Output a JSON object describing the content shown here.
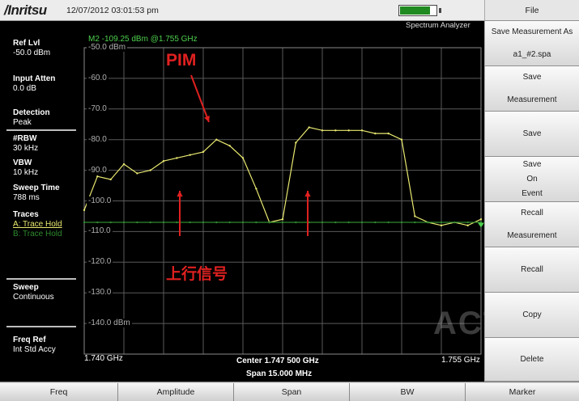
{
  "header": {
    "logo_text": "/Inritsu",
    "datetime": "12/07/2012 03:01:53 pm",
    "battery_level": 0.85,
    "mode_label": "Spectrum Analyzer"
  },
  "left_panel": {
    "ref_lvl": {
      "label": "Ref Lvl",
      "value": "-50.0 dBm"
    },
    "input_atten": {
      "label": "Input Atten",
      "value": "0.0 dB"
    },
    "detection": {
      "label": "Detection",
      "value": "Peak"
    },
    "rbw": {
      "label": "#RBW",
      "value": "30 kHz"
    },
    "vbw": {
      "label": "VBW",
      "value": "10 kHz"
    },
    "sweep_time": {
      "label": "Sweep Time",
      "value": "788 ms"
    },
    "traces": {
      "label": "Traces",
      "a": "A: Trace Hold",
      "b": "B: Trace Hold"
    },
    "sweep": {
      "label": "Sweep",
      "value": "Continuous"
    },
    "freq_ref": {
      "label": "Freq Ref",
      "value": "Int Std Accy"
    }
  },
  "right_panel": {
    "title": "File",
    "buttons": [
      {
        "line1": "Save Measurement As",
        "line2": "a1_#2.spa"
      },
      {
        "line1": "Save",
        "line2": "Measurement"
      },
      {
        "line1": "Save"
      },
      {
        "line1": "Save",
        "line2": "On",
        "line3": "Event"
      },
      {
        "line1": "Recall",
        "line2": "Measurement"
      },
      {
        "line1": "Recall"
      },
      {
        "line1": "Copy"
      },
      {
        "line1": "Delete"
      }
    ]
  },
  "bottom_tabs": [
    "Freq",
    "Amplitude",
    "Span",
    "BW",
    "Marker"
  ],
  "annotations": {
    "pim": "PIM",
    "uplink": "上行信号"
  },
  "watermark": "ACT",
  "chart_data": {
    "type": "line",
    "marker_readout": "M2 -109.25 dBm @1.755 GHz",
    "ytick_labels": [
      "-50.0 dBm",
      "-60.0",
      "-70.0",
      "-80.0",
      "-90.0",
      "-100.0",
      "-110.0",
      "-120.0",
      "-130.0",
      "-140.0 dBm"
    ],
    "ylim": [
      -150,
      -50
    ],
    "xlim": [
      1.74,
      1.755
    ],
    "x_start_label": "1.740 GHz",
    "x_end_label": "1.755 GHz",
    "center_label": "Center 1.747 500 GHz",
    "span_label": "Span 15.000 MHz",
    "grid": true,
    "series": [
      {
        "name": "A: Trace Hold",
        "color": "#e8e870",
        "x": [
          1.74,
          1.7405,
          1.741,
          1.7415,
          1.742,
          1.7425,
          1.743,
          1.7435,
          1.744,
          1.7445,
          1.745,
          1.7455,
          1.746,
          1.7465,
          1.747,
          1.7475,
          1.748,
          1.7485,
          1.749,
          1.7495,
          1.75,
          1.7505,
          1.751,
          1.7515,
          1.752,
          1.7525,
          1.753,
          1.7535,
          1.754,
          1.7545,
          1.755
        ],
        "y": [
          -103,
          -92,
          -93,
          -88,
          -91,
          -90,
          -87,
          -86,
          -85,
          -84,
          -80,
          -82,
          -86,
          -96,
          -107,
          -106,
          -81,
          -76,
          -77,
          -77,
          -77,
          -77,
          -78,
          -78,
          -80,
          -105,
          -107,
          -108,
          -107,
          -108,
          -106
        ]
      },
      {
        "name": "B: Trace Hold",
        "color": "#2f8a2f",
        "x": [
          1.74,
          1.7405,
          1.741,
          1.7415,
          1.742,
          1.7425,
          1.743,
          1.7435,
          1.744,
          1.7445,
          1.745,
          1.7455,
          1.746,
          1.7465,
          1.747,
          1.7475,
          1.748,
          1.7485,
          1.749,
          1.7495,
          1.75,
          1.7505,
          1.751,
          1.7515,
          1.752,
          1.7525,
          1.753,
          1.7535,
          1.754,
          1.7545,
          1.755
        ],
        "y": [
          -107,
          -107,
          -107,
          -107,
          -107,
          -107,
          -107,
          -107,
          -107,
          -107,
          -107,
          -107,
          -107,
          -107,
          -107,
          -107,
          -107,
          -107,
          -107,
          -107,
          -107,
          -107,
          -107,
          -107,
          -107,
          -107,
          -107,
          -107,
          -107,
          -107,
          -107
        ]
      }
    ]
  }
}
